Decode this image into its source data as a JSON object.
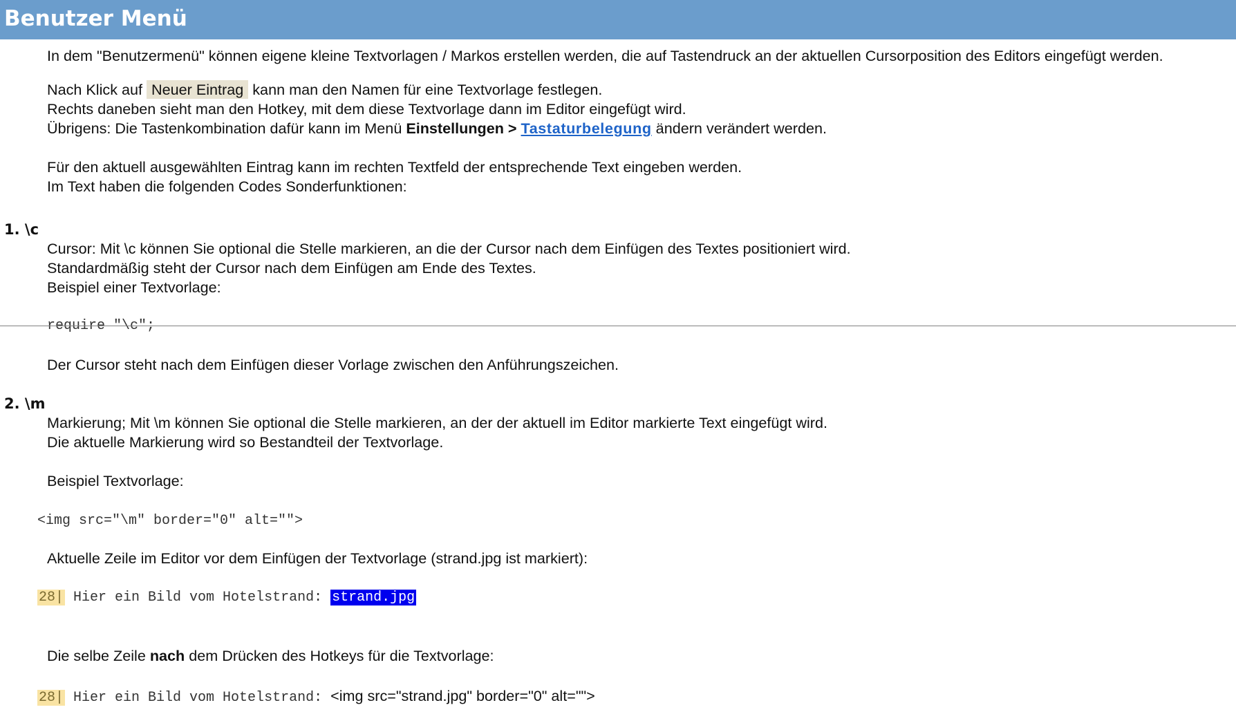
{
  "header": {
    "title": "Benutzer Menü"
  },
  "intro": {
    "line1": "In dem \"Benutzermenü\"  können eigene kleine Textvorlagen / Markos erstellen werden, die auf Tastendruck an der aktuellen Cursorposition des Editors eingefügt werden.",
    "line2_before": "Nach Klick auf ",
    "line2_button": "Neuer Eintrag",
    "line2_after": " kann man den Namen für eine Textvorlage festlegen.",
    "line3": "Rechts daneben sieht man den Hotkey, mit dem diese Textvorlage dann im Editor eingefügt wird.",
    "line4_before": "Übrigens: Die Tastenkombination dafür kann im Menü ",
    "line4_bold": "Einstellungen > ",
    "line4_link": "Tastaturbelegung",
    "line4_after": " ändern verändert werden.",
    "line5": "Für den aktuell ausgewählten Eintrag kann im rechten Textfeld der entsprechende Text eingeben werden.",
    "line6": "Im Text haben die folgenden Codes Sonderfunktionen:"
  },
  "section1": {
    "heading": "1. \\c",
    "line1": "Cursor: Mit \\c können Sie optional die Stelle markieren, an die der Cursor nach dem Einfügen des Textes positioniert wird.",
    "line2": "Standardmäßig steht der Cursor nach dem Einfügen am Ende des Textes.",
    "line3": "Beispiel einer Textvorlage:",
    "code": "require \"\\c\";",
    "line4": "Der Cursor steht nach dem Einfügen dieser Vorlage zwischen den Anführungszeichen."
  },
  "section2": {
    "heading": "2. \\m",
    "line1": "Markierung; Mit \\m können Sie optional die Stelle markieren, an der der aktuell im Editor markierte Text eingefügt wird.",
    "line2": "Die aktuelle Markierung wird so Bestandteil der Textvorlage.",
    "line3": "Beispiel Textvorlage:",
    "code": "<img src=\"\\m\"  border=\"0\" alt=\"\">",
    "line4": "Aktuelle Zeile im Editor vor dem Einfügen der Textvorlage (strand.jpg ist markiert):",
    "editor_before": {
      "line_number": "28|",
      "text": " Hier ein Bild vom Hotelstrand:  ",
      "selection": "strand.jpg"
    },
    "line5_before": "Die selbe Zeile ",
    "line5_bold": "nach",
    "line5_after": " dem Drücken des Hotkeys für die Textvorlage:",
    "editor_after": {
      "line_number": "28|",
      "text": " Hier ein Bild vom Hotelstrand: ",
      "inserted": "<img src=\"strand.jpg\"  border=\"0\" alt=\"\">"
    }
  }
}
